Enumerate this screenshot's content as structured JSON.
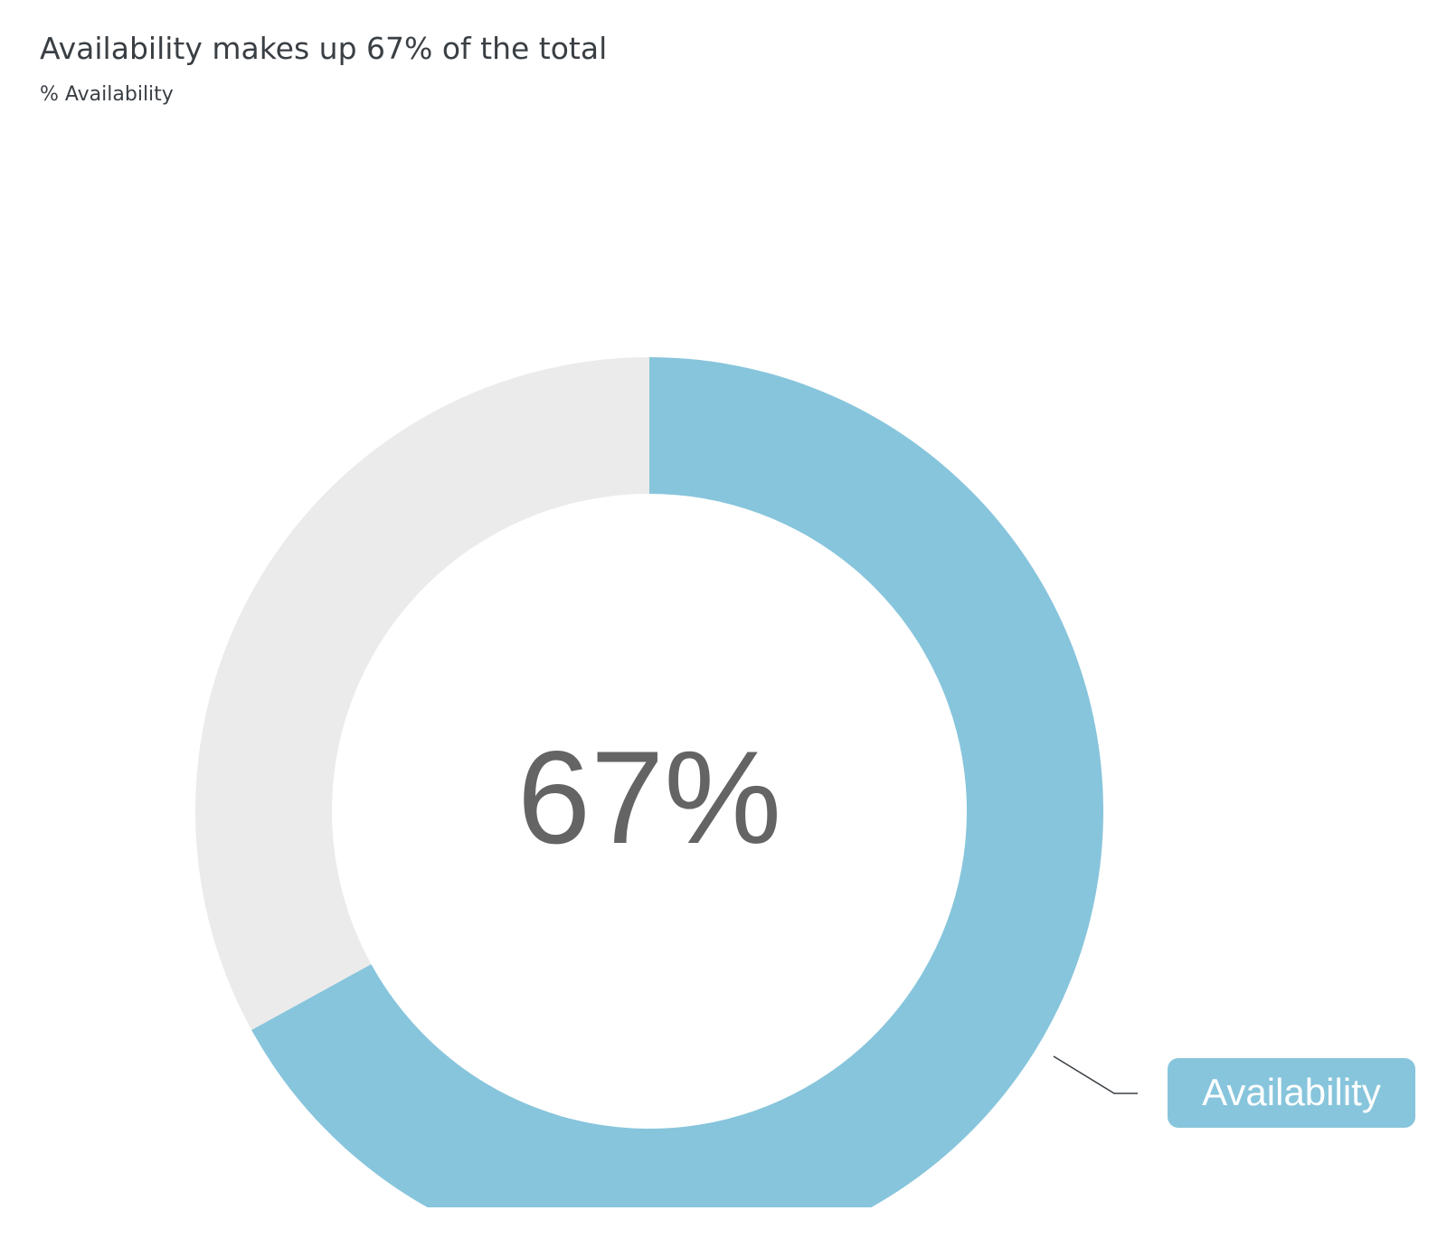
{
  "title": "Availability makes up 67% of the total",
  "subtitle": "% Availability",
  "center_label": "67%",
  "colors": {
    "primary": "#87c5dc",
    "remainder": "#ebebeb",
    "center_text": "#646464",
    "label_text": "#ffffff",
    "leader_line": "#3a3f44"
  },
  "chart_data": {
    "type": "pie",
    "variant": "donut",
    "title": "Availability makes up 67% of the total",
    "subtitle": "% Availability",
    "slices": [
      {
        "name": "Availability",
        "value": 67
      },
      {
        "name": "",
        "value": 33
      }
    ],
    "center_label": "67%",
    "slice_label": "Availability"
  }
}
